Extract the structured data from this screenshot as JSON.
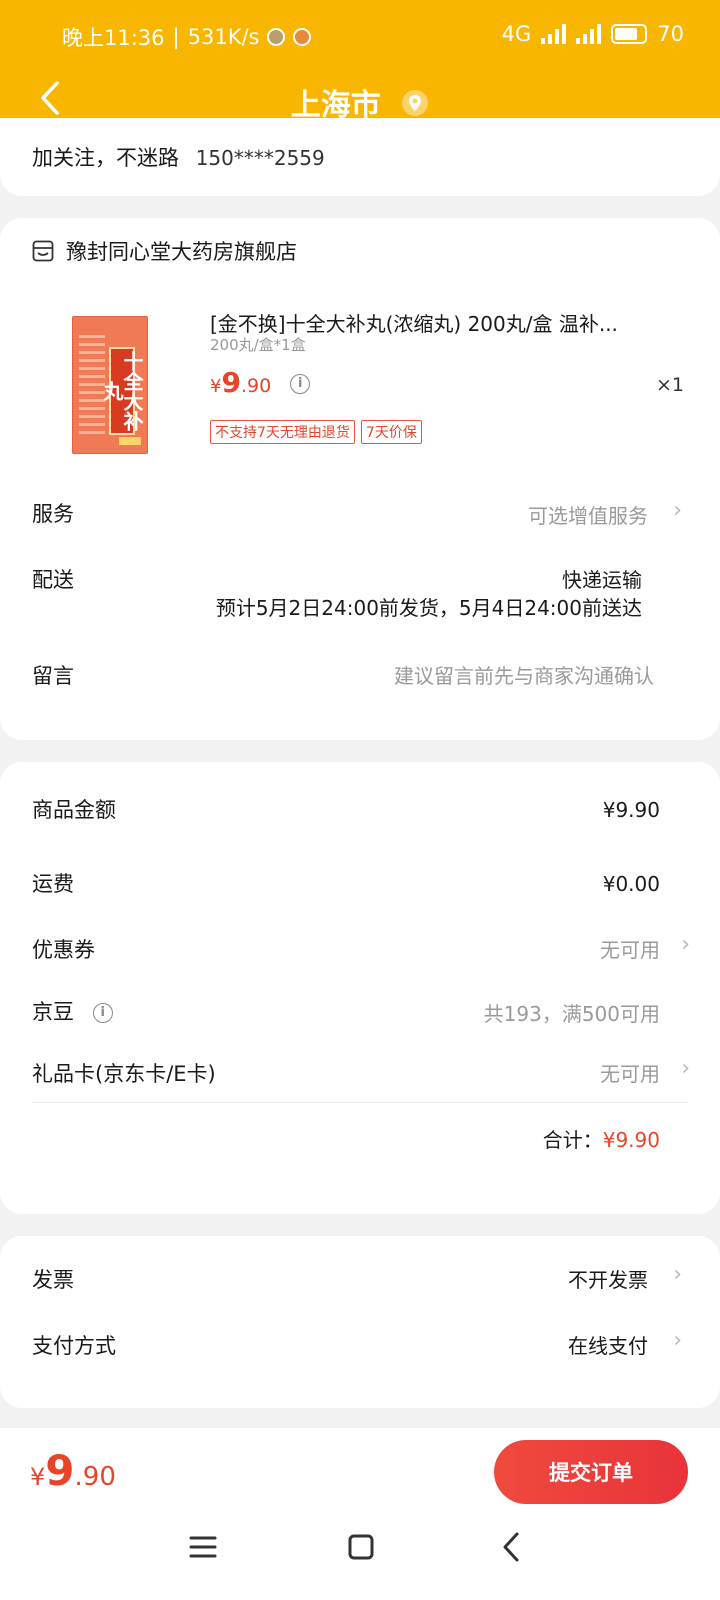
{
  "status_bar": {
    "time": "晚上11:36",
    "speed": "531K/s",
    "network": "4G",
    "battery": "70"
  },
  "header": {
    "title": "上海市"
  },
  "follow_bar": {
    "text": "加关注，不迷路",
    "phone": "150****2559"
  },
  "shop": {
    "name": "豫封同心堂大药房旗舰店"
  },
  "product": {
    "title": "[金不换]十全大补丸(浓缩丸) 200丸/盒 温补...",
    "spec": "200丸/盒*1盒",
    "price_symbol": "¥",
    "price_int": "9",
    "price_dec": ".90",
    "quantity": "×1",
    "image_text": "十全大补丸",
    "tags": [
      "不支持7天无理由退货",
      "7天价保"
    ]
  },
  "service": {
    "label": "服务",
    "value": "可选增值服务"
  },
  "delivery": {
    "label": "配送",
    "method": "快递运输",
    "estimate": "预计5月2日24:00前发货，5月4日24:00前送达"
  },
  "message": {
    "label": "留言",
    "placeholder": "建议留言前先与商家沟通确认"
  },
  "amounts": {
    "goods_label": "商品金额",
    "goods_value": "¥9.90",
    "shipping_label": "运费",
    "shipping_value": "¥0.00",
    "coupon_label": "优惠券",
    "coupon_value": "无可用",
    "jingdou_label": "京豆",
    "jingdou_value": "共193，满500可用",
    "giftcard_label": "礼品卡(京东卡/E卡)",
    "giftcard_value": "无可用",
    "total_label": "合计：",
    "total_value": "¥9.90"
  },
  "invoice": {
    "label": "发票",
    "value": "不开发票"
  },
  "payment": {
    "label": "支付方式",
    "value": "在线支付"
  },
  "bottom_bar": {
    "price_symbol": "¥",
    "price_int": "9",
    "price_dec": ".90",
    "submit_label": "提交订单"
  },
  "colors": {
    "header": "#f9b600",
    "accent_red": "#e8442a"
  }
}
